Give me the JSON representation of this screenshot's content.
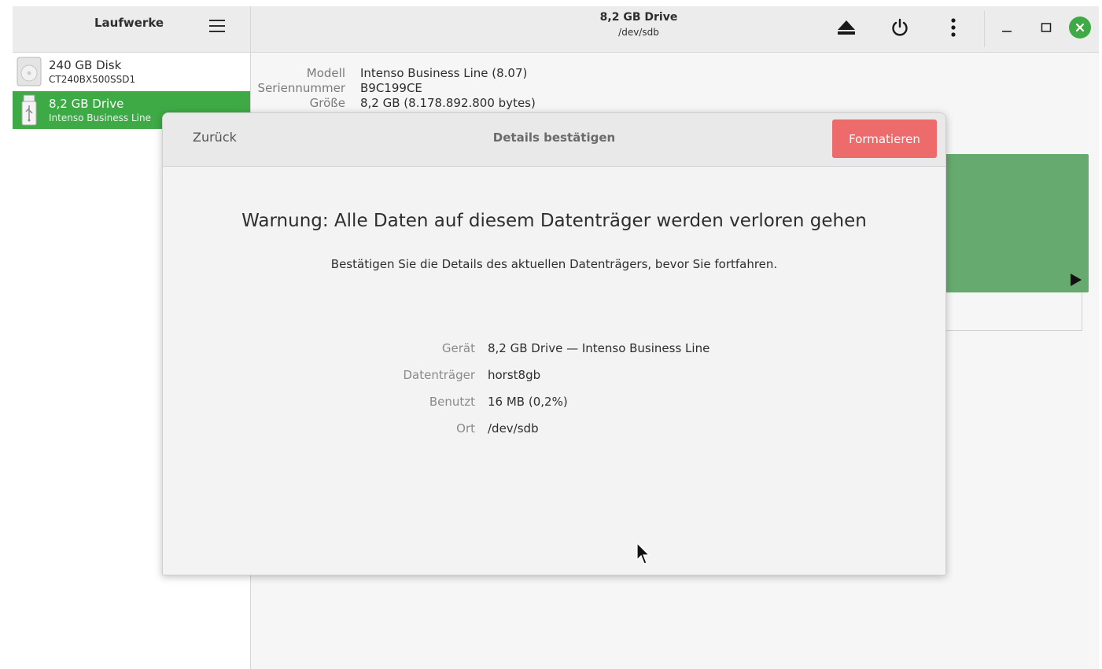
{
  "sidebar": {
    "title": "Laufwerke",
    "items": [
      {
        "name": "240 GB Disk",
        "sub": "CT240BX500SSD1",
        "icon": "hard-disk-icon"
      },
      {
        "name": "8,2 GB Drive",
        "sub": "Intenso Business Line",
        "icon": "usb-drive-icon"
      }
    ]
  },
  "header": {
    "title": "8,2 GB Drive",
    "subtitle": "/dev/sdb",
    "icons": [
      "eject-icon",
      "power-icon",
      "more-vertical-icon",
      "minimize-icon",
      "maximize-icon",
      "close-icon"
    ]
  },
  "drive_info": {
    "model_label": "Modell",
    "model_value": "Intenso Business Line (8.07)",
    "serial_label": "Seriennummer",
    "serial_value": "B9C199CE",
    "size_label": "Größe",
    "size_value": "8,2 GB (8.178.892.800 bytes)"
  },
  "dialog": {
    "back_label": "Zurück",
    "title": "Details bestätigen",
    "format_label": "Formatieren",
    "warning_title": "Warnung: Alle Daten auf diesem Datenträger werden verloren gehen",
    "warning_sub": "Bestätigen Sie die Details des aktuellen Datenträgers, bevor Sie fortfahren.",
    "details": [
      {
        "label": "Gerät",
        "value": "8,2 GB Drive — Intenso Business Line"
      },
      {
        "label": "Datenträger",
        "value": "horst8gb"
      },
      {
        "label": "Benutzt",
        "value": "16 MB (0,2%)"
      },
      {
        "label": "Ort",
        "value": "/dev/sdb"
      }
    ]
  },
  "colors": {
    "accent_green": "#3eaa46",
    "partition_green": "#66aa6f",
    "destructive_red": "#ed6b6b"
  }
}
